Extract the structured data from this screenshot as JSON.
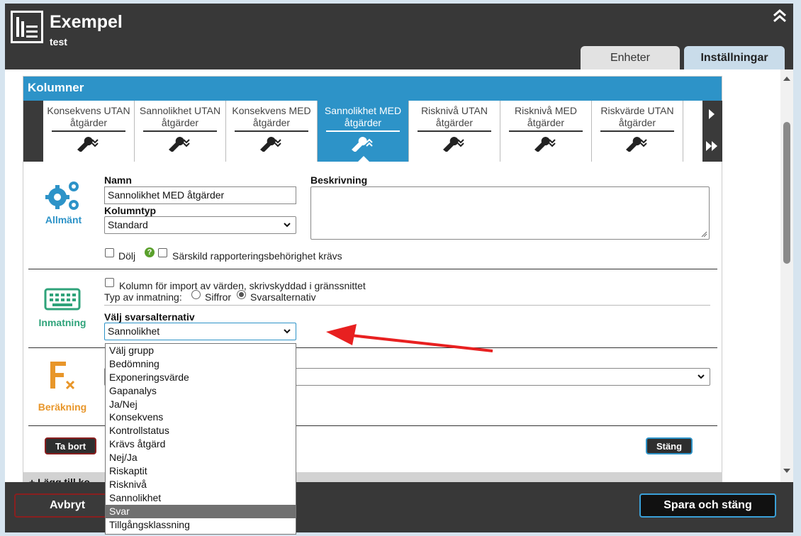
{
  "header": {
    "title": "Exempel",
    "subtitle": "test",
    "tabs": [
      {
        "label": "Enheter"
      },
      {
        "label": "Inställningar"
      }
    ]
  },
  "panel": {
    "title": "Kolumner",
    "column_tabs": [
      {
        "label": "Konsekvens UTAN åtgärder"
      },
      {
        "label": "Sannolikhet UTAN åtgärder"
      },
      {
        "label": "Konsekvens MED åtgärder"
      },
      {
        "label": "Sannolikhet MED åtgärder"
      },
      {
        "label": "Risknivå UTAN åtgärder"
      },
      {
        "label": "Risknivå MED åtgärder"
      },
      {
        "label": "Riskvärde UTAN åtgärder"
      }
    ]
  },
  "general": {
    "section_label": "Allmänt",
    "name_label": "Namn",
    "name_value": "Sannolikhet MED åtgärder",
    "coltype_label": "Kolumntyp",
    "coltype_value": "Standard",
    "description_label": "Beskrivning",
    "hide_label": "Dölj",
    "special_perm_label": "Särskild rapporteringsbehörighet krävs"
  },
  "input_section": {
    "section_label": "Inmatning",
    "import_label": "Kolumn för import av värden, skrivskyddad i gränssnittet",
    "input_type_label": "Typ av inmatning:",
    "radio_numbers": "Siffror",
    "radio_options": "Svarsalternativ",
    "choose_label": "Välj svarsalternativ",
    "choose_value": "Sannolikhet",
    "dropdown_options": [
      "Välj grupp",
      "Bedömning",
      "Exponeringsvärde",
      "Gapanalys",
      "Ja/Nej",
      "Konsekvens",
      "Kontrollstatus",
      "Krävs åtgärd",
      "Nej/Ja",
      "Riskaptit",
      "Risknivå",
      "Sannolikhet",
      "Svar",
      "Tillgångsklassning"
    ],
    "dropdown_highlighted": "Svar"
  },
  "calc_section": {
    "section_label": "Beräkning"
  },
  "actions": {
    "delete_label": "Ta bort",
    "close_label": "Stäng"
  },
  "add_strip": {
    "label": "+ Lägg till ko"
  },
  "footer": {
    "cancel_label": "Avbryt",
    "save_label": "Spara och stäng"
  },
  "colors": {
    "accent": "#2d93c8",
    "header_bg": "#383838",
    "input_icon": "#2fa37a",
    "calc_icon": "#e8962a"
  }
}
